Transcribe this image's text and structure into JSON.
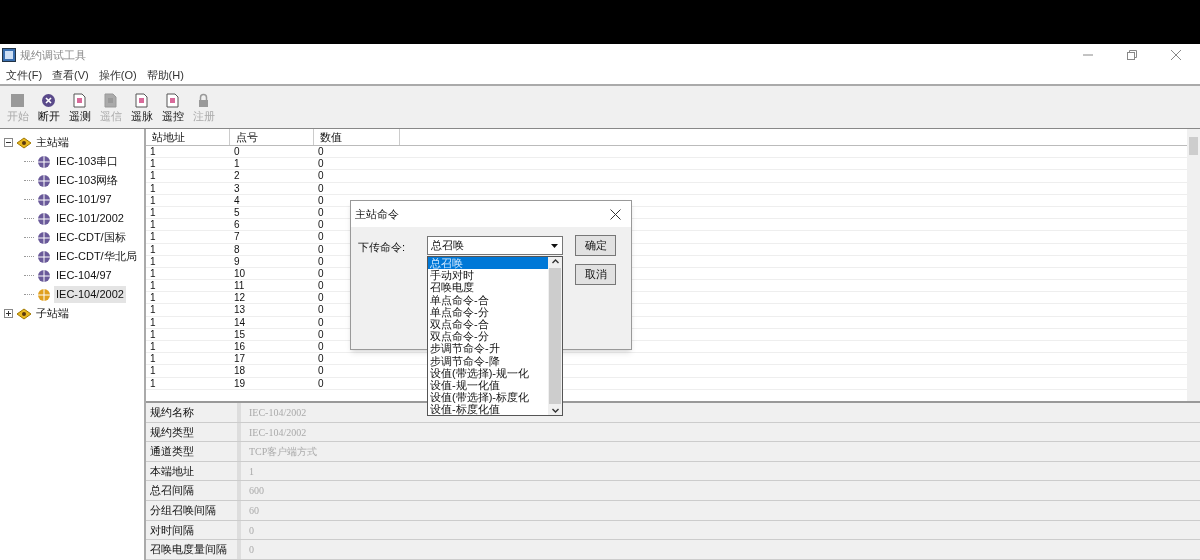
{
  "window": {
    "title": "规约调试工具"
  },
  "menu": [
    "文件(F)",
    "查看(V)",
    "操作(O)",
    "帮助(H)"
  ],
  "toolbar": [
    {
      "label": "开始",
      "kind": "square",
      "disabled": true
    },
    {
      "label": "断开",
      "kind": "disconnect",
      "disabled": false
    },
    {
      "label": "遥测",
      "kind": "doc",
      "disabled": false
    },
    {
      "label": "遥信",
      "kind": "doc",
      "disabled": true
    },
    {
      "label": "遥脉",
      "kind": "doc",
      "disabled": false
    },
    {
      "label": "遥控",
      "kind": "doc",
      "disabled": false
    },
    {
      "label": "注册",
      "kind": "lock",
      "disabled": true
    }
  ],
  "tree": [
    {
      "label": "主站端",
      "expanded": true,
      "selected": false,
      "children": [
        {
          "label": "IEC-103串口",
          "selected": false
        },
        {
          "label": "IEC-103网络",
          "selected": false
        },
        {
          "label": "IEC-101/97",
          "selected": false
        },
        {
          "label": "IEC-101/2002",
          "selected": false
        },
        {
          "label": "IEC-CDT/国标",
          "selected": false
        },
        {
          "label": "IEC-CDT/华北局",
          "selected": false
        },
        {
          "label": "IEC-104/97",
          "selected": false
        },
        {
          "label": "IEC-104/2002",
          "selected": true
        }
      ]
    },
    {
      "label": "子站端",
      "expanded": false,
      "selected": false
    }
  ],
  "table": {
    "columns": [
      "站地址",
      "点号",
      "数值"
    ],
    "rows": [
      [
        "1",
        "0",
        "0"
      ],
      [
        "1",
        "1",
        "0"
      ],
      [
        "1",
        "2",
        "0"
      ],
      [
        "1",
        "3",
        "0"
      ],
      [
        "1",
        "4",
        "0"
      ],
      [
        "1",
        "5",
        "0"
      ],
      [
        "1",
        "6",
        "0"
      ],
      [
        "1",
        "7",
        "0"
      ],
      [
        "1",
        "8",
        "0"
      ],
      [
        "1",
        "9",
        "0"
      ],
      [
        "1",
        "10",
        "0"
      ],
      [
        "1",
        "11",
        "0"
      ],
      [
        "1",
        "12",
        "0"
      ],
      [
        "1",
        "13",
        "0"
      ],
      [
        "1",
        "14",
        "0"
      ],
      [
        "1",
        "15",
        "0"
      ],
      [
        "1",
        "16",
        "0"
      ],
      [
        "1",
        "17",
        "0"
      ],
      [
        "1",
        "18",
        "0"
      ],
      [
        "1",
        "19",
        "0"
      ]
    ]
  },
  "properties": [
    {
      "label": "规约名称",
      "value": "IEC-104/2002"
    },
    {
      "label": "规约类型",
      "value": "IEC-104/2002"
    },
    {
      "label": "通道类型",
      "value": "TCP客户端方式"
    },
    {
      "label": "本端地址",
      "value": "1"
    },
    {
      "label": "总召间隔",
      "value": "600"
    },
    {
      "label": "分组召唤间隔",
      "value": "60"
    },
    {
      "label": "对时间隔",
      "value": "0"
    },
    {
      "label": "召唤电度量间隔",
      "value": "0"
    }
  ],
  "dialog": {
    "title": "主站命令",
    "field_label": "下传命令:",
    "combo_value": "总召唤",
    "options": [
      {
        "label": "总召唤",
        "selected": true
      },
      {
        "label": "手动对时",
        "selected": false
      },
      {
        "label": "召唤电度",
        "selected": false
      },
      {
        "label": "单点命令-合",
        "selected": false
      },
      {
        "label": "单点命令-分",
        "selected": false
      },
      {
        "label": "双点命令-合",
        "selected": false
      },
      {
        "label": "双点命令-分",
        "selected": false
      },
      {
        "label": "步调节命令-升",
        "selected": false
      },
      {
        "label": "步调节命令-降",
        "selected": false
      },
      {
        "label": "设值(带选择)-规一化",
        "selected": false
      },
      {
        "label": "设值-规一化值",
        "selected": false
      },
      {
        "label": "设值(带选择)-标度化",
        "selected": false
      },
      {
        "label": "设值-标度化值",
        "selected": false
      }
    ],
    "buttons": [
      "确定",
      "取消"
    ]
  }
}
